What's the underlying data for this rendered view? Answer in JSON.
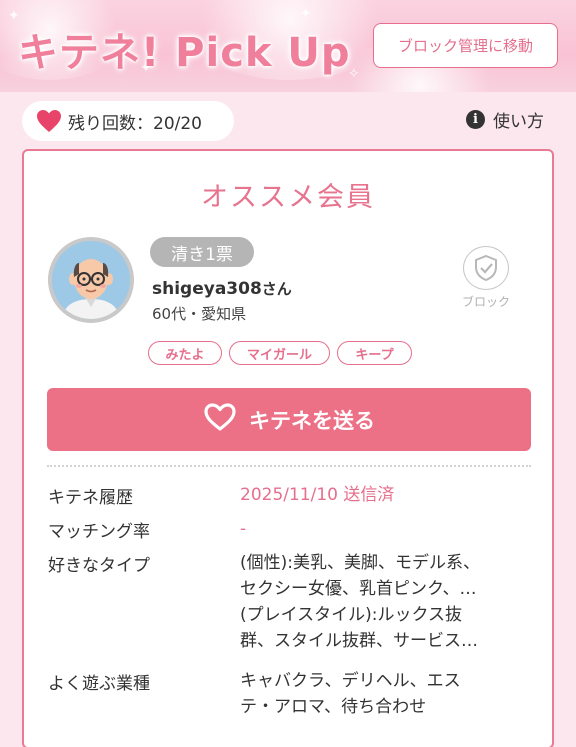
{
  "header": {
    "title": "キテネ! Pick Up",
    "block_manage_label": "ブロック管理に移動"
  },
  "remaining": {
    "label": "残り回数：20/20",
    "icon": "heart-icon"
  },
  "howto": {
    "label": "使い方",
    "icon": "info-icon"
  },
  "card": {
    "title": "オススメ会員",
    "user": {
      "badge": "清き1票",
      "name": "shigeya308",
      "honorific": "さん",
      "age_area": "60代・愛知県"
    },
    "block": {
      "label": "ブロック",
      "icon": "shield-check-icon"
    },
    "tags": [
      "みたよ",
      "マイガール",
      "キープ"
    ],
    "send_button": {
      "label": "キテネを送る",
      "icon": "heart-outline-icon"
    },
    "details": {
      "history_label": "キテネ履歴",
      "history_value": "2025/11/10 送信済",
      "match_label": "マッチング率",
      "match_value": "-",
      "type_label": "好きなタイプ",
      "type_line1": "(個性):美乳、美脚、モデル系、",
      "type_line2": "セクシー女優、乳首ピンク、…",
      "type_line3": "(プレイスタイル):ルックス抜",
      "type_line4": "群、スタイル抜群、サービス…",
      "genre_label": "よく遊ぶ業種",
      "genre_line1": "キャバクラ、デリヘル、エス",
      "genre_line2": "テ・アロマ、待ち合わせ"
    }
  },
  "colors": {
    "accent": "#e56f8c",
    "button": "#ec7086",
    "background": "#fde7ef"
  }
}
